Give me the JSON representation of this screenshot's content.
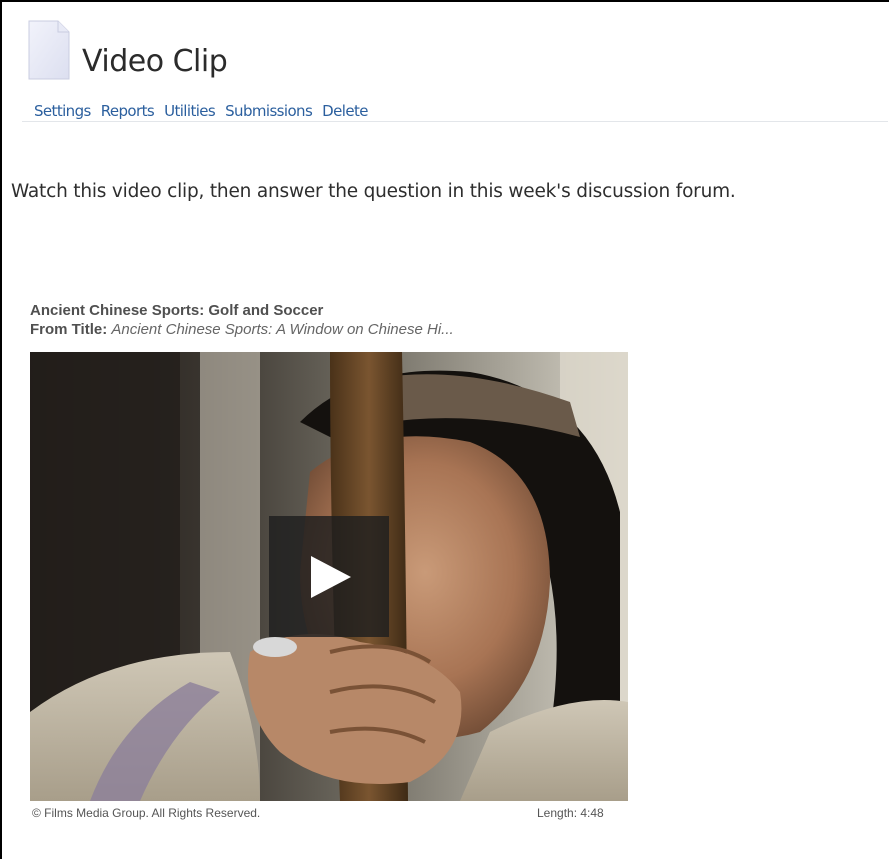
{
  "page": {
    "title": "Video Clip",
    "icon": "document-icon"
  },
  "tabs": [
    {
      "label": "Settings"
    },
    {
      "label": "Reports"
    },
    {
      "label": "Utilities"
    },
    {
      "label": "Submissions"
    },
    {
      "label": "Delete"
    }
  ],
  "content": {
    "instructions": "Watch this video clip, then answer the question in this week's discussion forum."
  },
  "video": {
    "title": "Ancient Chinese Sports: Golf and Soccer",
    "from_label": "From Title:",
    "from_value": "Ancient Chinese Sports: A Window on Chinese Hi...",
    "copyright": "© Films Media Group. All Rights Reserved.",
    "length": "Length: 4:48",
    "play_icon": "play-icon"
  },
  "colors": {
    "link": "#2b5f9e",
    "title_text": "#2b2b2b",
    "body_text": "#2e2e2e"
  }
}
